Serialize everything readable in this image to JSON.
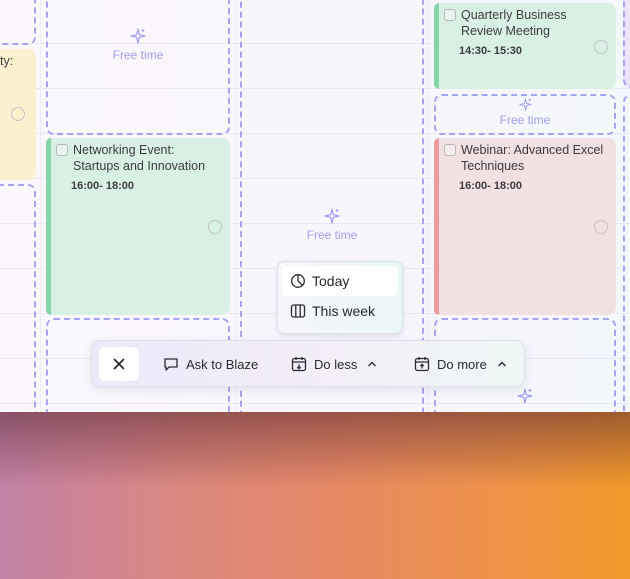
{
  "calendar": {
    "free_label": "Free time",
    "partial_event_title": "ty:",
    "events": [
      {
        "title": "Networking Event: Startups and Innovation",
        "time": "16:00- 18:00",
        "color": "#d9f1e4"
      },
      {
        "title": "Quarterly Business Review Meeting",
        "time": "14:30- 15:30",
        "color": "#d9f1e4"
      },
      {
        "title": "Webinar: Advanced Excel Techniques",
        "time": "16:00- 18:00",
        "color": "#f2e1e2"
      }
    ]
  },
  "scope_menu": {
    "items": [
      {
        "label": "Today",
        "icon": "clock-icon",
        "selected": true
      },
      {
        "label": "This week",
        "icon": "columns-icon",
        "selected": false
      }
    ]
  },
  "toolbar": {
    "close_icon": "close-icon",
    "ask_label": "Ask to Blaze",
    "do_less_label": "Do less",
    "do_more_label": "Do more"
  }
}
